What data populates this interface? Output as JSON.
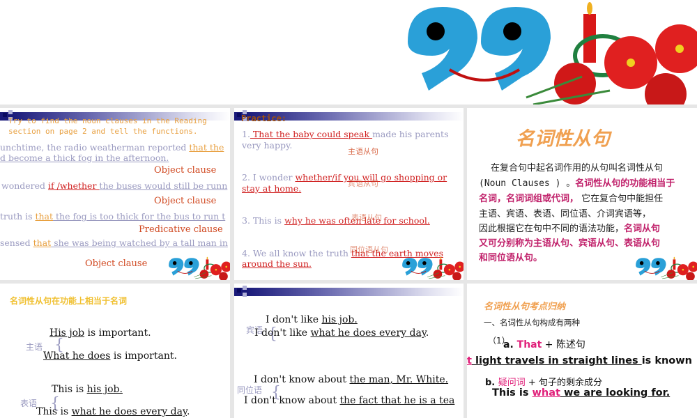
{
  "slides": [
    {
      "title_line1": "Try to find the noun clauses in the Reading",
      "title_line2": "section on page 2 and tell the functions.",
      "s1a": "unchtime, the radio weatherman reported ",
      "s1b": "that the",
      "s1c": "d become a thick fog in the afternoon.",
      "l1": "Object clause",
      "s2a": "wondered ",
      "s2b": "if /whether ",
      "s2c": "the buses would still be runn",
      "l2": "Object clause",
      "s3a": "truth is ",
      "s3b": "that",
      "s3c": " the fog is too thick for the bus to run t",
      "l3": "Predicative  clause",
      "s4a": "sensed ",
      "s4b": "that",
      "s4c": " she was being watched by a tall man in",
      "l4": "Object clause"
    },
    {
      "title": "Practice:",
      "p1a": "1.",
      "p1b": " That the baby could speak ",
      "p1c": "made his parents",
      "p1d": "very happy.",
      "a1": "主语从句",
      "p2a": "2. I wonder ",
      "p2b": "whether/if you will go shopping or",
      "p2c": "stay at home.",
      "a2": "宾语从句",
      "p3a": "3. This is ",
      "p3b": "why he was often late for school.",
      "a3": "表语从句",
      "p4a": "4. We all know the truth ",
      "p4b": "that the earth moves",
      "p4c": "around the sun.",
      "a4": "同位语从句"
    },
    {
      "title": "名词性从句",
      "l1": "在复合句中起名词作用的从句叫名词性从句",
      "l2a": "(Noun Clauses ) 。",
      "l2b": "名词性从句的功能相当于",
      "l3a": "名词，名词词组或代词，",
      "l3b": " 它在复合句中能担任",
      "l4": "主语、宾语、表语、同位语、介词宾语等，",
      "l5a": "因此根据它在句中不同的语法功能，",
      "l5b": "名词从句",
      "l6": "又可分别称为主语从句、宾语从句、表语从句",
      "l7": "和同位语从句。"
    },
    {
      "title": "名词性从句在功能上相当于名词",
      "e1a": "His job",
      "e1b": " is important.",
      "e2a": "What he does",
      "e2b": " is important.",
      "lab1": "主语",
      "e3a": "This is ",
      "e3b": "his job.",
      "e4a": "This is ",
      "e4b": "what he does every day",
      "e4c": ".",
      "lab2": "表语"
    },
    {
      "e1a": "I don't like ",
      "e1b": "his job.",
      "e2a": "I don't like ",
      "e2b": "what he does every day",
      "e2c": ".",
      "lab1": "宾语",
      "e3a": "I don't know about ",
      "e3b": "the man, Mr. White.",
      "e4a": "I don't know about ",
      "e4b": "the fact that he is a tea",
      "lab2": "同位语"
    },
    {
      "title": "名词性从句考点归纳",
      "h1": "一、名词性从句构成有两种",
      "n1": "（1）",
      "a_label": "a. ",
      "a_that": "That",
      "a_rest": " +  陈述句",
      "ex1a": "t",
      "ex1b": " light travels in straight lines ",
      "ex1c": "is known",
      "b_label": "b.  ",
      "b_word": "疑问词",
      "b_rest": " + 句子的剩余成分",
      "ex2a": "This is ",
      "ex2b": "what",
      "ex2c": " we are looking for."
    }
  ],
  "colors": {
    "logo_blue": "#2aa0d8",
    "candle_red": "#d81818",
    "flower_red": "#e02020"
  }
}
